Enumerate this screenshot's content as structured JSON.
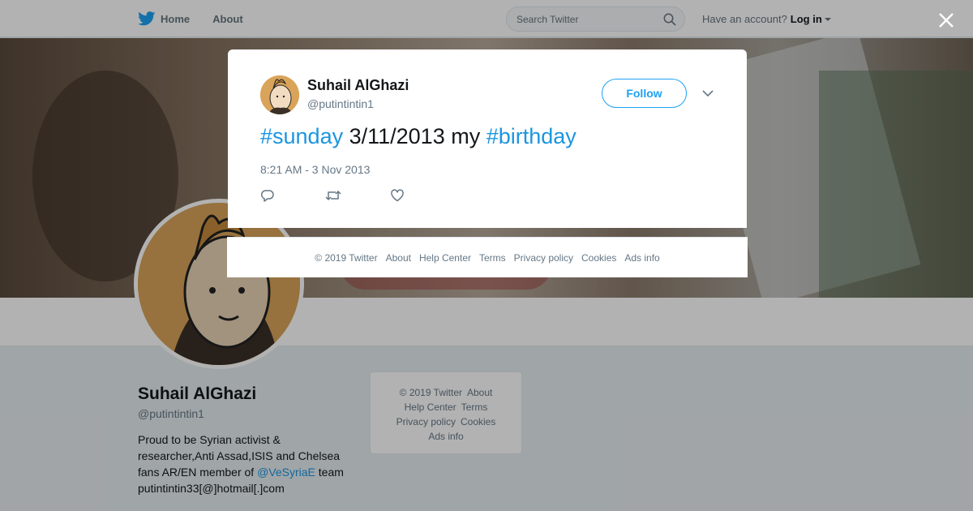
{
  "nav": {
    "home": "Home",
    "about": "About",
    "search_placeholder": "Search Twitter",
    "account_prompt": "Have an account?",
    "login": "Log in"
  },
  "profile": {
    "name": "Suhail AlGhazi",
    "handle": "@putintintin1",
    "bio_before": "Proud to be Syrian activist & researcher,Anti Assad,ISIS and Chelsea fans AR/EN member of ",
    "bio_mention": "@VeSyriaE",
    "bio_after": " team putintintin33[@]hotmail[.]com"
  },
  "side_footer": {
    "copyright": "© 2019 Twitter",
    "about": "About",
    "help": "Help Center",
    "terms": "Terms",
    "privacy": "Privacy policy",
    "cookies": "Cookies",
    "ads": "Ads info"
  },
  "tweet": {
    "name": "Suhail AlGhazi",
    "handle": "@putintintin1",
    "follow_label": "Follow",
    "tag1": "#sunday",
    "middle": " 3/11/2013 my ",
    "tag2": "#birthday",
    "timestamp": "8:21 AM - 3 Nov 2013"
  },
  "modal_footer": {
    "copyright": "© 2019 Twitter",
    "about": "About",
    "help": "Help Center",
    "terms": "Terms",
    "privacy": "Privacy policy",
    "cookies": "Cookies",
    "ads": "Ads info"
  },
  "colors": {
    "brand": "#1da1f2",
    "link": "#1b95e0",
    "avatar_bg": "#d9a45a"
  },
  "icons": [
    "twitter-bird-icon",
    "home-icon",
    "search-icon",
    "close-icon",
    "chevron-down-icon",
    "reply-icon",
    "retweet-icon",
    "like-icon"
  ]
}
